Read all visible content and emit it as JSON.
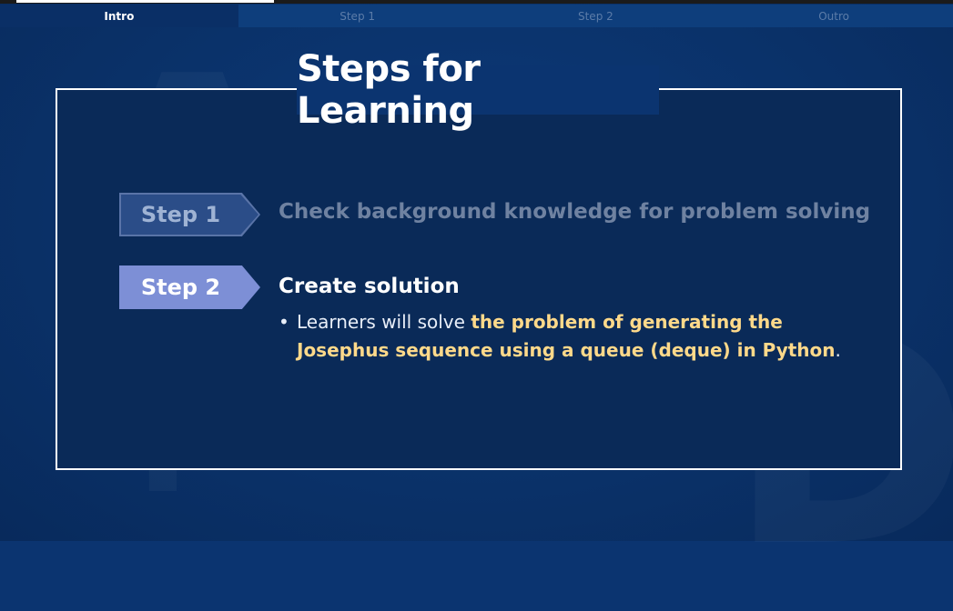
{
  "tabs": [
    {
      "label": "Intro",
      "active": true
    },
    {
      "label": "Step 1",
      "active": false
    },
    {
      "label": "Step 2",
      "active": false
    },
    {
      "label": "Outro",
      "active": false
    }
  ],
  "progress_fraction": 0.27,
  "slide": {
    "title": "Steps for Learning",
    "steps": [
      {
        "tag": "Step 1",
        "text": "Check background knowledge for problem solving"
      },
      {
        "tag": "Step 2",
        "heading": "Create solution",
        "bullet_prefix": "Learners will solve ",
        "bullet_highlight": "the problem of generating the Josephus sequence using a queue (deque) in Python",
        "bullet_suffix": "."
      }
    ]
  },
  "colors": {
    "background": "#0b3470",
    "highlight": "#ffd98a",
    "step2_tag": "#7d8fd6",
    "step1_tag": "#2b4d88"
  }
}
